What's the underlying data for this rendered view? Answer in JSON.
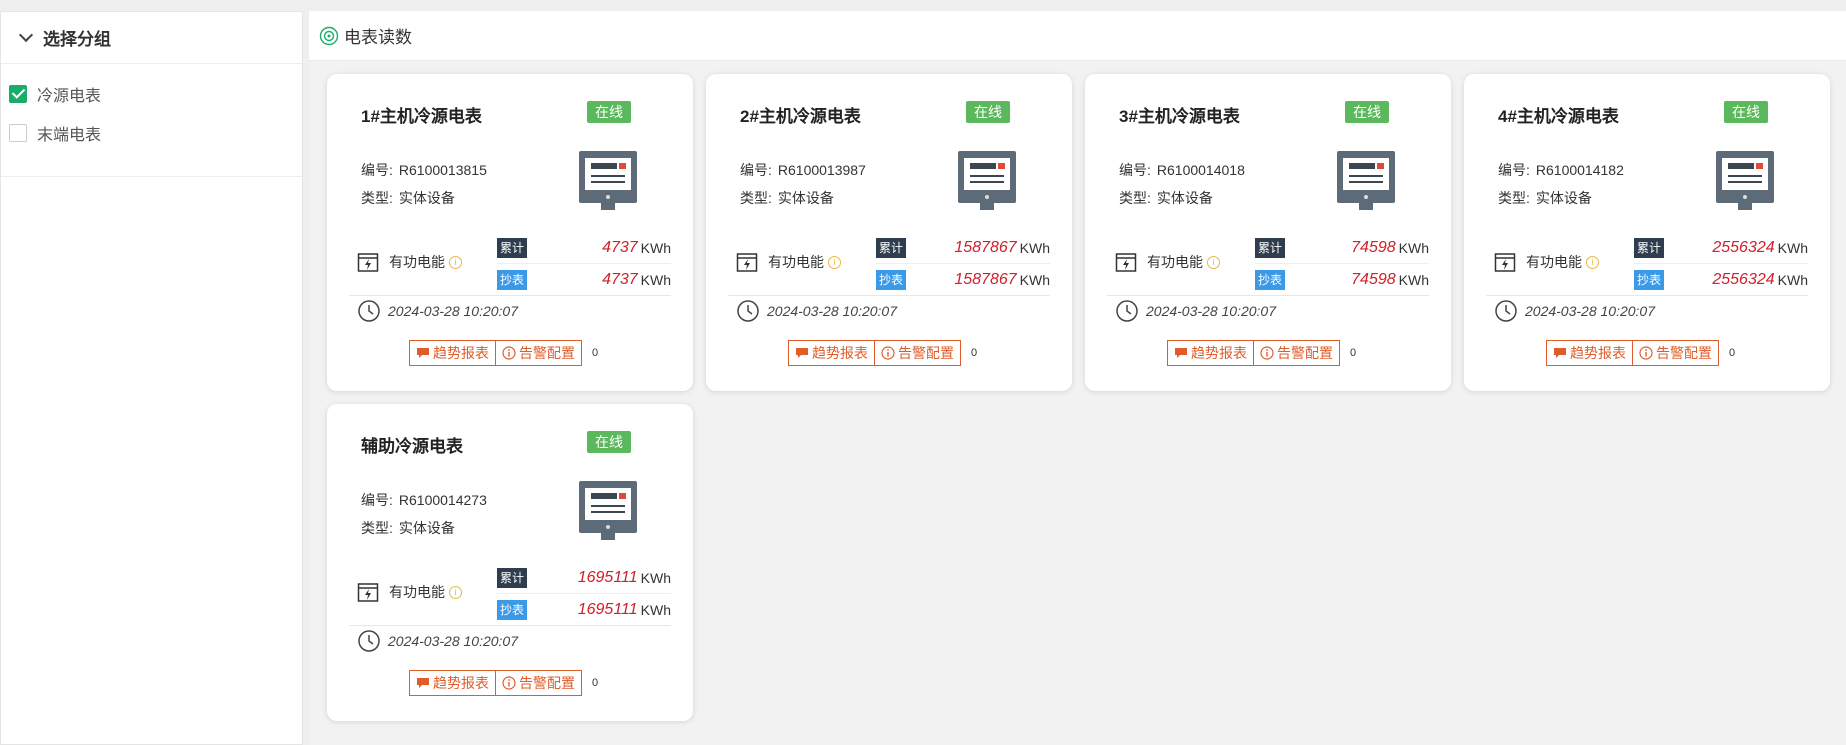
{
  "sidebar": {
    "title": "选择分组",
    "groups": [
      {
        "label": "冷源电表",
        "checked": true
      },
      {
        "label": "末端电表",
        "checked": false
      }
    ]
  },
  "main": {
    "title": "电表读数"
  },
  "labels": {
    "code_key": "编号:",
    "type_key": "类型:",
    "energy": "有功电能",
    "tag_total": "累计",
    "tag_read": "抄表",
    "unit": "KWh",
    "trend_button": "趋势报表",
    "alarm_button": "告警配置"
  },
  "cards": [
    {
      "title": "1#主机冷源电表",
      "status": "在线",
      "code": "R6100013815",
      "type": "实体设备",
      "total": "4737",
      "read": "4737",
      "time": "2024-03-28 10:20:07",
      "count": "0"
    },
    {
      "title": "2#主机冷源电表",
      "status": "在线",
      "code": "R6100013987",
      "type": "实体设备",
      "total": "1587867",
      "read": "1587867",
      "time": "2024-03-28 10:20:07",
      "count": "0"
    },
    {
      "title": "3#主机冷源电表",
      "status": "在线",
      "code": "R6100014018",
      "type": "实体设备",
      "total": "74598",
      "read": "74598",
      "time": "2024-03-28 10:20:07",
      "count": "0"
    },
    {
      "title": "4#主机冷源电表",
      "status": "在线",
      "code": "R6100014182",
      "type": "实体设备",
      "total": "2556324",
      "read": "2556324",
      "time": "2024-03-28 10:20:07",
      "count": "0"
    },
    {
      "title": "辅助冷源电表",
      "status": "在线",
      "code": "R6100014273",
      "type": "实体设备",
      "total": "1695111",
      "read": "1695111",
      "time": "2024-03-28 10:20:07",
      "count": "0"
    }
  ],
  "colors": {
    "online": "#5cb85c",
    "value": "#d0202a",
    "action": "#e05c2a",
    "accent": "#1aad6a"
  }
}
